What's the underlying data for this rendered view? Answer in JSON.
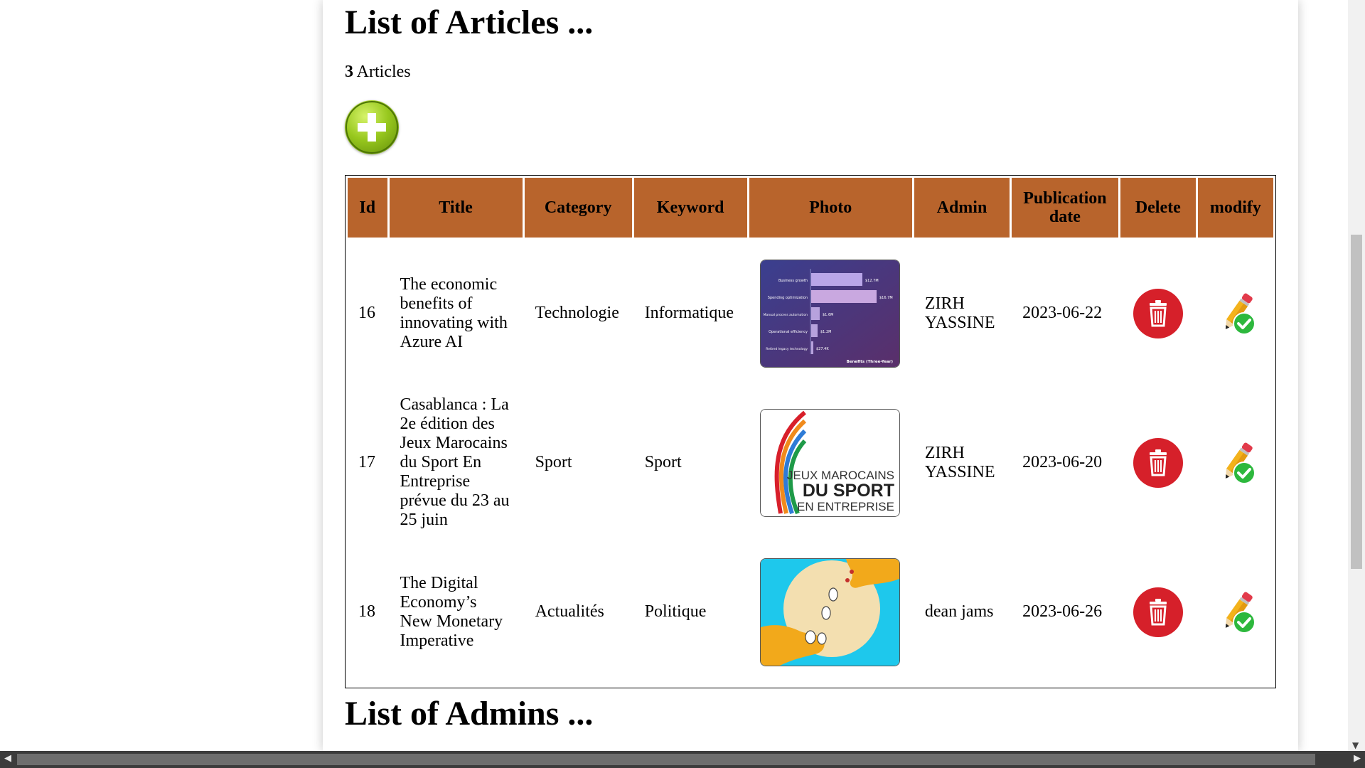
{
  "headings": {
    "articles": "List of Articles ...",
    "admins": "List of Admins ..."
  },
  "count": {
    "number": "3",
    "label": " Articles"
  },
  "add_icon": "plus-circle-icon",
  "table": {
    "headers": [
      "Id",
      "Title",
      "Category",
      "Keyword",
      "Photo",
      "Admin",
      "Publication date",
      "Delete",
      "modify"
    ],
    "rows": [
      {
        "id": "16",
        "title": "The economic benefits of innovating with Azure AI",
        "category": "Technologie",
        "keyword": "Informatique",
        "photo": "azure-benefits-chart-thumbnail",
        "admin": "ZIRH YASSINE",
        "date": "2023-06-22"
      },
      {
        "id": "17",
        "title": "Casablanca : La 2e édition des Jeux Marocains du Sport En Entreprise prévue du 23 au 25 juin",
        "category": "Sport",
        "keyword": "Sport",
        "photo": "jeux-marocains-logo-thumbnail",
        "admin": "ZIRH YASSINE",
        "date": "2023-06-20"
      },
      {
        "id": "18",
        "title": "The Digital Economy’s New Monetary Imperative",
        "category": "Actualités",
        "keyword": "Politique",
        "photo": "hands-coins-illustration-thumbnail",
        "admin": "dean jams",
        "date": "2023-06-26"
      }
    ]
  },
  "thumb_text": {
    "azure_rows": [
      "Business growth",
      "Spending optimization",
      "Manual process automation",
      "Operational efficiency",
      "Retired legacy technology"
    ],
    "azure_values": [
      "$12.7M",
      "$16.7M",
      "$1.6M",
      "$1.2M",
      "$27.4K"
    ],
    "azure_caption": "Benefits (Three-Year)",
    "jeux_line1": "JEUX MAROCAINS",
    "jeux_line2": "DU SPORT",
    "jeux_line3": "EN ENTREPRISE"
  },
  "icons": {
    "delete": "trash-icon",
    "modify": "pencil-check-icon"
  },
  "colors": {
    "header_bg": "#b8642c",
    "delete_bg": "#d6202a",
    "add_green": "#98c81e",
    "check_green": "#2db83d"
  }
}
